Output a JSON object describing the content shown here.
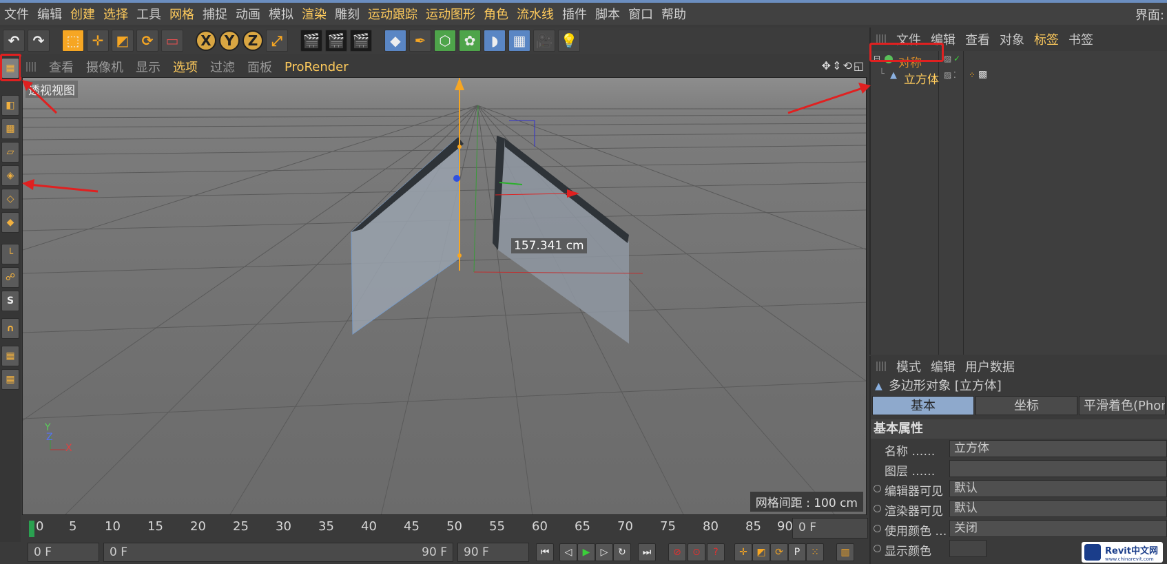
{
  "menubar": {
    "items": [
      "文件",
      "编辑",
      "创建",
      "选择",
      "工具",
      "网格",
      "捕捉",
      "动画",
      "模拟",
      "渲染",
      "雕刻",
      "运动跟踪",
      "运动图形",
      "角色",
      "流水线",
      "插件",
      "脚本",
      "窗口",
      "帮助"
    ],
    "highlighted": [
      2,
      3,
      9,
      11,
      12,
      13,
      14
    ],
    "right_label": "界面:"
  },
  "toolbar": {
    "buttons": [
      "undo",
      "redo",
      "select",
      "move",
      "scale",
      "rotate",
      "select-box",
      "x-axis",
      "y-axis",
      "z-axis",
      "coord",
      "render-view",
      "render",
      "render-settings",
      "cube",
      "pen",
      "subdiv",
      "cloner",
      "deformer",
      "floor",
      "camera",
      "light"
    ],
    "x_label": "X",
    "y_label": "Y",
    "z_label": "Z"
  },
  "viewport": {
    "menu": [
      "查看",
      "摄像机",
      "显示",
      "选项",
      "过滤",
      "面板",
      "ProRender"
    ],
    "active_menu": "选项",
    "view_name": "透视视图",
    "measure": "157.341 cm",
    "grid_spacing": "网格间距 : 100 cm",
    "axis_y": "Y",
    "axis_z": "Z",
    "axis_x": "X"
  },
  "timeline": {
    "ticks": [
      "0",
      "5",
      "10",
      "15",
      "20",
      "25",
      "30",
      "35",
      "40",
      "45",
      "50",
      "55",
      "60",
      "65",
      "70",
      "75",
      "80",
      "85",
      "90"
    ],
    "current_frame_field": "0 F"
  },
  "transport": {
    "start": "0 F",
    "range_start": "0 F",
    "range_end": "90 F",
    "end": "90 F"
  },
  "object_manager": {
    "menu": [
      "文件",
      "编辑",
      "查看",
      "对象",
      "标签",
      "书签"
    ],
    "active_menu": "标签",
    "objects": [
      {
        "name": "对称",
        "level": 0
      },
      {
        "name": "立方体",
        "level": 1
      }
    ]
  },
  "attribute_manager": {
    "menu": [
      "模式",
      "编辑",
      "用户数据"
    ],
    "object_title": "多边形对象 [立方体]",
    "tabs": [
      "基本",
      "坐标",
      "平滑着色(Phong)"
    ],
    "active_tab": "基本",
    "section": "基本属性",
    "fields": [
      {
        "label": "名称 ……",
        "value": "立方体",
        "radio": false
      },
      {
        "label": "图层 ……",
        "value": "",
        "radio": false
      },
      {
        "label": "编辑器可见",
        "value": "默认",
        "radio": true
      },
      {
        "label": "渲染器可见",
        "value": "默认",
        "radio": true
      },
      {
        "label": "使用颜色 …",
        "value": "关闭",
        "radio": true
      },
      {
        "label": "显示颜色",
        "value": "",
        "radio": true
      }
    ]
  },
  "watermark": {
    "brand": "Revit中文网",
    "url": "www.chinarevit.com"
  }
}
